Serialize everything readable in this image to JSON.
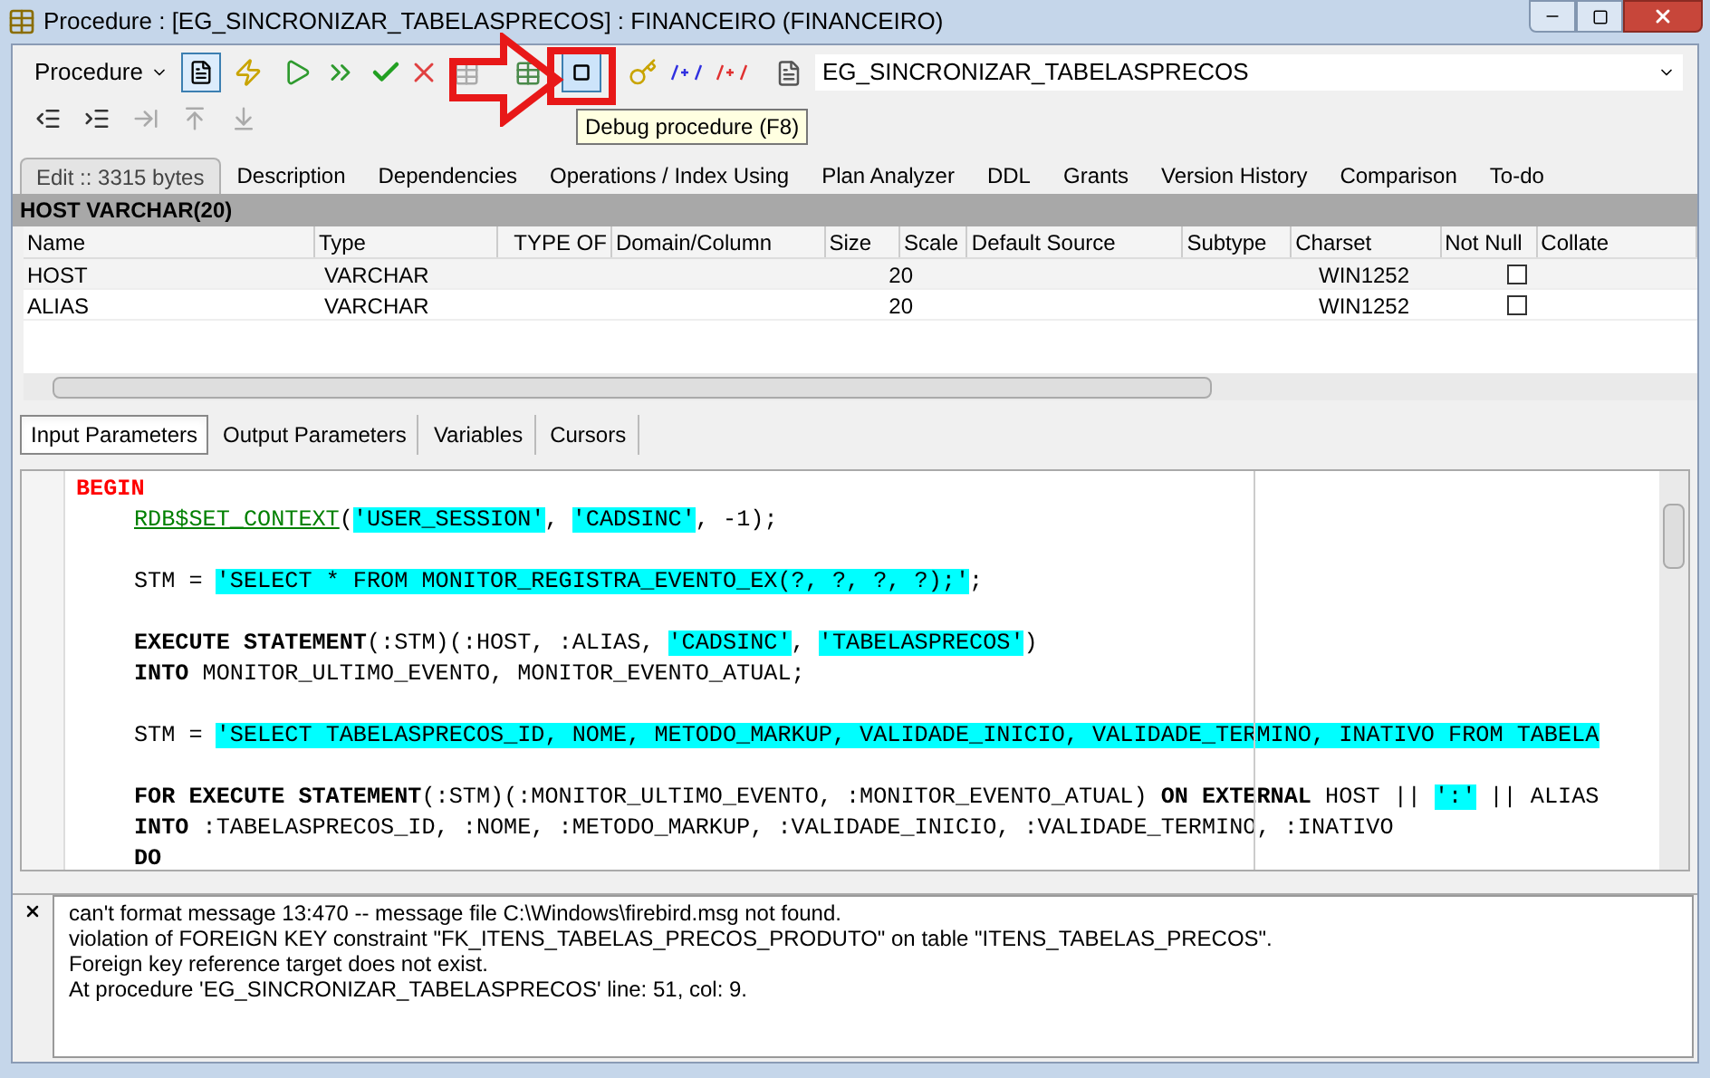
{
  "window": {
    "title": "Procedure : [EG_SINCRONIZAR_TABELASPRECOS] : FINANCEIRO (FINANCEIRO)"
  },
  "toolbar": {
    "object_type": "Procedure",
    "object_name": "EG_SINCRONIZAR_TABELASPRECOS"
  },
  "tooltip": "Debug procedure (F8)",
  "tabs": [
    {
      "label": "Edit :: 3315 bytes",
      "selected": true
    },
    {
      "label": "Description",
      "selected": false
    },
    {
      "label": "Dependencies",
      "selected": false
    },
    {
      "label": "Operations / Index Using",
      "selected": false
    },
    {
      "label": "Plan Analyzer",
      "selected": false
    },
    {
      "label": "DDL",
      "selected": false
    },
    {
      "label": "Grants",
      "selected": false
    },
    {
      "label": "Version History",
      "selected": false
    },
    {
      "label": "Comparison",
      "selected": false
    },
    {
      "label": "To-do",
      "selected": false
    }
  ],
  "param_header": "HOST VARCHAR(20)",
  "grid": {
    "columns": [
      "Name",
      "Type",
      "TYPE OF",
      "Domain/Column",
      "Size",
      "Scale",
      "Default Source",
      "Subtype",
      "Charset",
      "Not Null",
      "Collate"
    ],
    "rows": [
      {
        "name": "HOST",
        "type": "VARCHAR",
        "size": "20",
        "charset": "WIN1252",
        "not_null": false
      },
      {
        "name": "ALIAS",
        "type": "VARCHAR",
        "size": "20",
        "charset": "WIN1252",
        "not_null": false
      }
    ]
  },
  "sub_tabs": [
    {
      "label": "Input Parameters",
      "selected": true
    },
    {
      "label": "Output Parameters",
      "selected": false
    },
    {
      "label": "Variables",
      "selected": false
    },
    {
      "label": "Cursors",
      "selected": false
    }
  ],
  "code": [
    {
      "kind": "code",
      "indent": false,
      "segments": [
        {
          "kind": "block",
          "text": "BEGIN"
        }
      ]
    },
    {
      "kind": "code",
      "indent": true,
      "segments": [
        {
          "kind": "func",
          "text": "RDB$SET_CONTEXT"
        },
        {
          "kind": "plain",
          "text": "("
        },
        {
          "kind": "string",
          "text": "'USER_SESSION'"
        },
        {
          "kind": "plain",
          "text": ", "
        },
        {
          "kind": "string",
          "text": "'CADSINC'"
        },
        {
          "kind": "plain",
          "text": ", -1);"
        }
      ]
    },
    {
      "kind": "blank"
    },
    {
      "kind": "code",
      "indent": true,
      "segments": [
        {
          "kind": "plain",
          "text": "STM = "
        },
        {
          "kind": "string",
          "text": "'SELECT * FROM MONITOR_REGISTRA_EVENTO_EX(?, ?, ?, ?);'"
        },
        {
          "kind": "plain",
          "text": ";"
        }
      ]
    },
    {
      "kind": "blank"
    },
    {
      "kind": "code",
      "indent": true,
      "segments": [
        {
          "kind": "keyword",
          "text": "EXECUTE STATEMENT"
        },
        {
          "kind": "plain",
          "text": "(:STM)(:HOST, :ALIAS, "
        },
        {
          "kind": "string",
          "text": "'CADSINC'"
        },
        {
          "kind": "plain",
          "text": ", "
        },
        {
          "kind": "string",
          "text": "'TABELASPRECOS'"
        },
        {
          "kind": "plain",
          "text": ")"
        }
      ]
    },
    {
      "kind": "code",
      "indent": true,
      "segments": [
        {
          "kind": "keyword",
          "text": "INTO"
        },
        {
          "kind": "plain",
          "text": " MONITOR_ULTIMO_EVENTO, MONITOR_EVENTO_ATUAL;"
        }
      ]
    },
    {
      "kind": "blank"
    },
    {
      "kind": "code",
      "indent": true,
      "segments": [
        {
          "kind": "plain",
          "text": "STM = "
        },
        {
          "kind": "string",
          "text": "'SELECT TABELASPRECOS_ID, NOME, METODO_MARKUP, VALIDADE_INICIO, VALIDADE_TERMINO, INATIVO FROM TABELA"
        }
      ]
    },
    {
      "kind": "blank"
    },
    {
      "kind": "code",
      "indent": true,
      "segments": [
        {
          "kind": "keyword",
          "text": "FOR EXECUTE STATEMENT"
        },
        {
          "kind": "plain",
          "text": "(:STM)(:MONITOR_ULTIMO_EVENTO, :MONITOR_EVENTO_ATUAL) "
        },
        {
          "kind": "keyword",
          "text": "ON EXTERNAL"
        },
        {
          "kind": "plain",
          "text": " HOST || "
        },
        {
          "kind": "string",
          "text": "':'"
        },
        {
          "kind": "plain",
          "text": " || ALIAS"
        }
      ]
    },
    {
      "kind": "code",
      "indent": true,
      "segments": [
        {
          "kind": "keyword",
          "text": "INTO"
        },
        {
          "kind": "plain",
          "text": " :TABELASPRECOS_ID, :NOME, :METODO_MARKUP, :VALIDADE_INICIO, :VALIDADE_TERMINO, :INATIVO"
        }
      ]
    },
    {
      "kind": "code",
      "indent": true,
      "segments": [
        {
          "kind": "keyword",
          "text": "DO"
        }
      ]
    }
  ],
  "messages": [
    "can't format message 13:470 -- message file C:\\Windows\\firebird.msg not found.",
    "violation of FOREIGN KEY constraint \"FK_ITENS_TABELAS_PRECOS_PRODUTO\" on table \"ITENS_TABELAS_PRECOS\".",
    "Foreign key reference target does not exist.",
    "At procedure 'EG_SINCRONIZAR_TABELASPRECOS' line: 51, col: 9."
  ]
}
